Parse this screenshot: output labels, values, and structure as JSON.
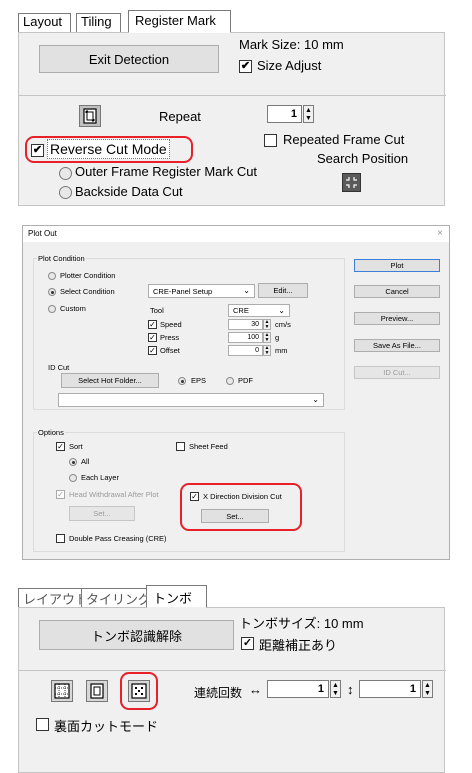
{
  "panel1": {
    "tabs": [
      "Layout",
      "Tiling",
      "Register Mark"
    ],
    "exit_detection": "Exit Detection",
    "mark_size": "Mark Size:  10 mm",
    "size_adjust": "Size Adjust",
    "repeat": "Repeat",
    "repeat_value": "1",
    "repeated_frame_cut": "Repeated Frame Cut",
    "reverse_cut_mode": "Reverse Cut Mode",
    "outer_frame": "Outer Frame Register Mark Cut",
    "search_position": "Search Position",
    "backside_data_cut": "Backside Data Cut"
  },
  "panel2": {
    "title": "Plot Out",
    "close": "×",
    "plot_condition": "Plot Condition",
    "plotter_condition": "Plotter Condition",
    "select_condition": "Select Condition",
    "custom": "Custom",
    "condition_value": "CRE-Panel Setup",
    "edit": "Edit...",
    "tool": "Tool",
    "tool_value": "CRE",
    "speed": "Speed",
    "speed_value": "30",
    "speed_unit": "cm/s",
    "press": "Press",
    "press_value": "100",
    "press_unit": "g",
    "offset": "Offset",
    "offset_value": "0",
    "offset_unit": "mm",
    "id_cut_label": "ID Cut",
    "select_hot_folder": "Select Hot Folder...",
    "eps": "EPS",
    "pdf": "PDF",
    "options": "Options",
    "sort": "Sort",
    "all": "All",
    "each_layer": "Each Layer",
    "head_withdrawal": "Head Withdrawal After Plot",
    "set1": "Set...",
    "sheet_feed": "Sheet Feed",
    "x_direction": "X Direction Division Cut",
    "set2": "Set...",
    "double_pass": "Double Pass Creasing (CRE)",
    "plot": "Plot",
    "cancel": "Cancel",
    "preview": "Preview...",
    "save_as_file": "Save As File...",
    "id_cut_button": "ID Cut..."
  },
  "panel3": {
    "tabs": [
      "レイアウト",
      "タイリング",
      "トンボ"
    ],
    "exit_detection": "トンボ認識解除",
    "mark_size": "トンボサイズ:  10 mm",
    "distance_correction": "距離補正あり",
    "repeat_count": "連続回数",
    "h_arrow": "↔",
    "v_arrow": "↕",
    "value1": "1",
    "value2": "1",
    "reverse_cut_mode": "裏面カットモード"
  },
  "colors": {
    "highlight": "#e8202a",
    "dialog_bg": "#f0f0f0",
    "link_blue": "#0040c0"
  }
}
